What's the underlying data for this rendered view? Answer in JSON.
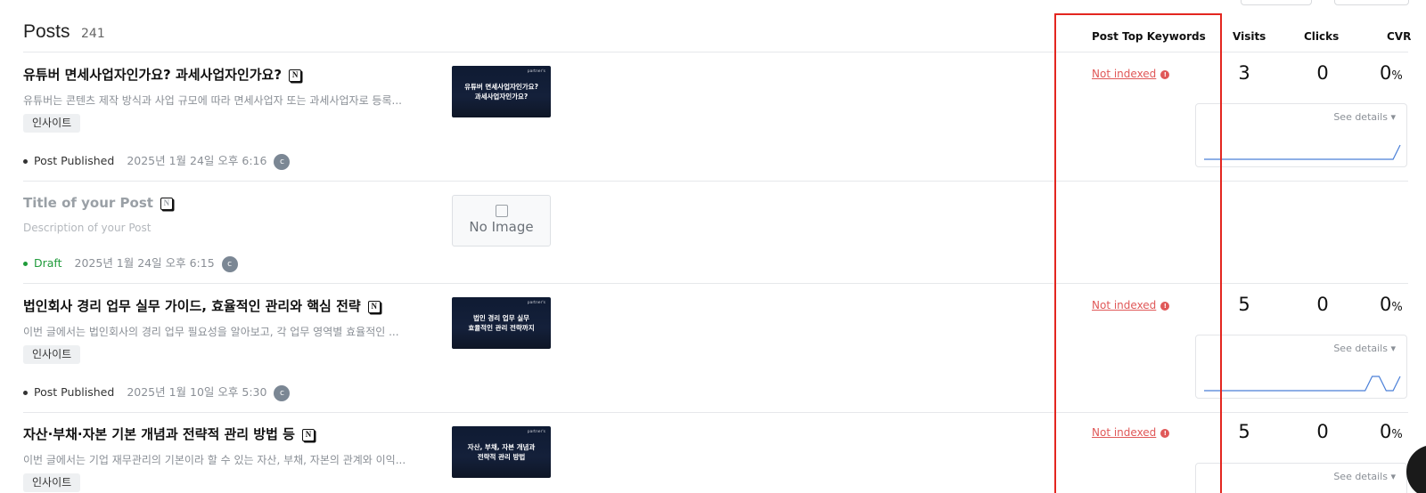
{
  "header": {
    "title": "Posts",
    "count": "241",
    "columns": {
      "keywords": "Post Top Keywords",
      "visits": "Visits",
      "clicks": "Clicks",
      "cvr": "CVR"
    }
  },
  "common": {
    "notion_badge": "N",
    "avatar_initial": "c",
    "not_indexed": "Not indexed",
    "info_glyph": "!",
    "see_details": "See details ▾",
    "percent": "%",
    "thumb_brand": "partner's"
  },
  "posts": [
    {
      "title": "유튜버 면세사업자인가요? 과세사업자인가요?",
      "description": "유튜버는 콘텐츠 제작 방식과 사업 규모에 따라 면세사업자 또는 과세사업자로 등록...",
      "tag": "인사이트",
      "status": "Post Published",
      "date": "2025년 1월 24일 오후 6:16",
      "thumbnail_text": "유튜버 면세사업자인가요?\n과세사업자인가요?",
      "keywords_status": "Not indexed",
      "visits": "3",
      "clicks": "0",
      "cvr": "0",
      "spark": [
        0,
        0,
        0,
        0,
        0,
        0,
        0,
        0,
        0,
        0,
        0,
        0,
        0,
        0,
        0,
        0,
        0,
        0,
        0,
        0,
        0,
        0,
        0,
        0,
        0,
        0,
        0,
        0,
        1
      ]
    },
    {
      "title": "Title of your Post",
      "description": "Description of your Post",
      "status": "Draft",
      "date": "2025년 1월 24일 오후 6:15",
      "no_image": "No Image"
    },
    {
      "title": "법인회사 경리 업무 실무 가이드, 효율적인 관리와 핵심 전략",
      "description": "이번 글에서는 법인회사의 경리 업무 필요성을 알아보고, 각 업무 영역별 효율적인 ...",
      "tag": "인사이트",
      "status": "Post Published",
      "date": "2025년 1월 10일 오후 5:30",
      "thumbnail_text": "법인 경리 업무 실무\n효율적인 관리 전략까지",
      "keywords_status": "Not indexed",
      "visits": "5",
      "clicks": "0",
      "cvr": "0",
      "spark": [
        0,
        0,
        0,
        0,
        0,
        0,
        0,
        0,
        0,
        0,
        0,
        0,
        0,
        0,
        0,
        0,
        0,
        0,
        0,
        0,
        0,
        0,
        0,
        0,
        1,
        1,
        0,
        0,
        1
      ]
    },
    {
      "title": "자산·부채·자본 기본 개념과 전략적 관리 방법 등",
      "description": "이번 글에서는 기업 재무관리의 기본이라 할 수 있는 자산, 부채, 자본의 관계와 이익...",
      "tag": "인사이트",
      "thumbnail_text": "자산, 부채, 자본 개념과\n전략적 관리 방법",
      "keywords_status": "Not indexed",
      "visits": "5",
      "clicks": "0",
      "cvr": "0"
    }
  ]
}
